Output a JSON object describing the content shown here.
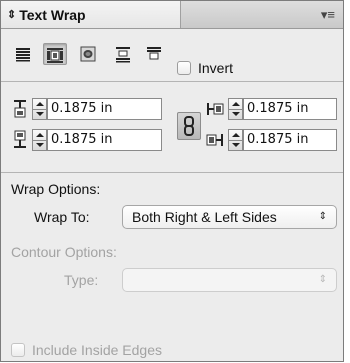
{
  "panel": {
    "tab_glyph": "⇕",
    "title": "Text Wrap",
    "menu_glyph": "▾≡"
  },
  "wrap_modes": {
    "selected": "wrap-around-bounding-box",
    "items": [
      "no-text-wrap",
      "wrap-around-bounding-box",
      "wrap-around-object-shape",
      "jump-object",
      "jump-to-next-column"
    ]
  },
  "invert": {
    "label": "Invert",
    "checked": false
  },
  "offsets": {
    "top": "0.1875 in",
    "bottom": "0.1875 in",
    "left": "0.1875 in",
    "right": "0.1875 in",
    "linked": true
  },
  "wrap_options": {
    "heading": "Wrap Options:",
    "wrap_to_label": "Wrap To:",
    "wrap_to_value": "Both Right & Left Sides",
    "arrow": "▲▼"
  },
  "contour_options": {
    "heading": "Contour Options:",
    "type_label": "Type:",
    "type_value": "",
    "arrow": "▲▼",
    "enabled": false
  },
  "include_inside_edges": {
    "label": "Include Inside Edges",
    "checked": false,
    "enabled": false
  }
}
